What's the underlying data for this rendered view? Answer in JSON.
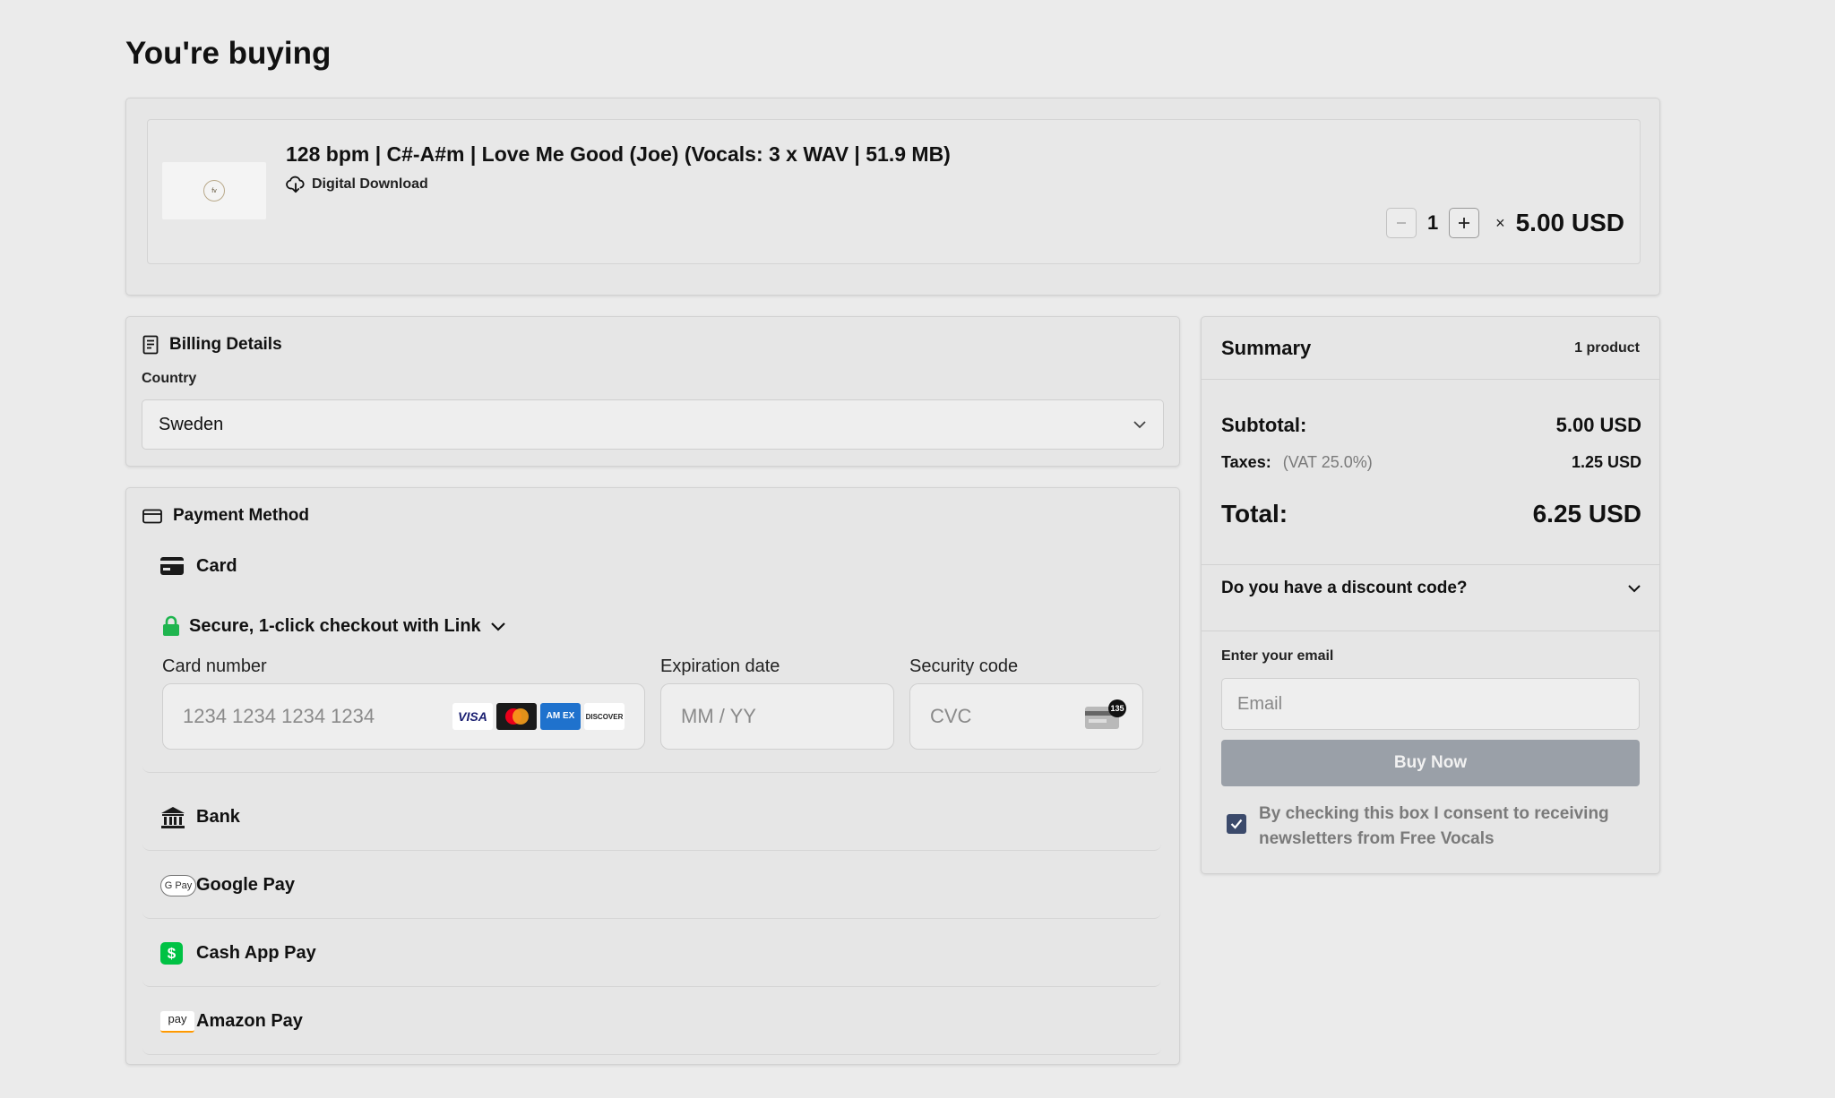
{
  "page": {
    "title": "You're buying"
  },
  "product": {
    "title": "128 bpm | C#-A#m | Love Me Good (Joe) (Vocals: 3 x WAV | 51.9 MB)",
    "delivery": "Digital Download",
    "quantity": "1",
    "times": "×",
    "unit_price": "5.00 USD",
    "thumb_text": "Free Vocals"
  },
  "billing": {
    "heading": "Billing Details",
    "country_label": "Country",
    "country_value": "Sweden"
  },
  "payment": {
    "heading": "Payment Method",
    "card_label": "Card",
    "link_text": "Secure, 1-click checkout with Link",
    "card_number_label": "Card number",
    "card_number_placeholder": "1234 1234 1234 1234",
    "expiry_label": "Expiration date",
    "expiry_placeholder": "MM / YY",
    "cvc_label": "Security code",
    "cvc_placeholder": "CVC",
    "cvc_badge": "135",
    "brands": [
      "VISA",
      "AM EX",
      "DISCOVER"
    ],
    "methods": [
      {
        "label": "Bank",
        "icon": "bank-icon"
      },
      {
        "label": "Google Pay",
        "icon": "google-pay-icon"
      },
      {
        "label": "Cash App Pay",
        "icon": "cash-app-icon"
      },
      {
        "label": "Amazon Pay",
        "icon": "amazon-pay-icon"
      }
    ],
    "gpay_text": "G Pay",
    "amazon_text": "pay",
    "cash_text": "$"
  },
  "summary": {
    "title": "Summary",
    "count": "1 product",
    "subtotal_label": "Subtotal:",
    "subtotal_value": "5.00 USD",
    "taxes_label": "Taxes:",
    "taxes_note": "(VAT 25.0%)",
    "taxes_value": "1.25 USD",
    "total_label": "Total:",
    "total_value": "6.25 USD",
    "discount_label": "Do you have a discount code?",
    "email_label": "Enter your email",
    "email_placeholder": "Email",
    "buy_label": "Buy Now",
    "consent_text": "By checking this box I consent to receiving newsletters from Free Vocals",
    "consent_checked": true
  },
  "colors": {
    "background": "#ebebeb",
    "buy_button": "#9aa0a8",
    "link_green": "#1fb54f",
    "checkbox": "#3b4a6b"
  }
}
